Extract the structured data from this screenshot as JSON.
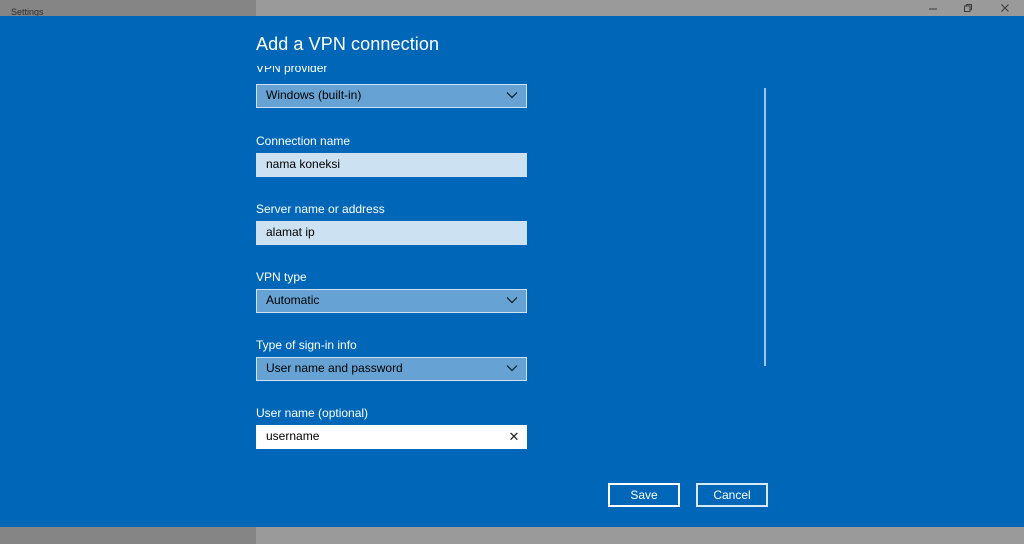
{
  "window": {
    "app_title": "Settings",
    "controls": [
      "minimize",
      "restore",
      "close"
    ]
  },
  "dialog": {
    "title": "Add a VPN connection",
    "fields": {
      "vpn_provider": {
        "label": "VPN provider",
        "value": "Windows (built-in)"
      },
      "connection_name": {
        "label": "Connection name",
        "value": "nama koneksi"
      },
      "server": {
        "label": "Server name or address",
        "value": "alamat ip"
      },
      "vpn_type": {
        "label": "VPN type",
        "value": "Automatic"
      },
      "signin_type": {
        "label": "Type of sign-in info",
        "value": "User name and password"
      },
      "username": {
        "label": "User name (optional)",
        "value": "username"
      }
    },
    "buttons": {
      "save": "Save",
      "cancel": "Cancel"
    }
  },
  "colors": {
    "dialog_bg": "#0067b8",
    "select_bg": "#66a3d4",
    "textbox_bg": "#cce1f1"
  }
}
